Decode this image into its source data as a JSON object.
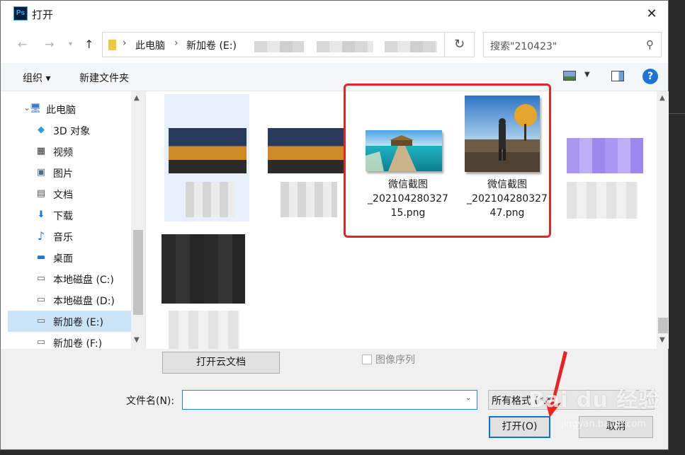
{
  "window": {
    "title": "打开",
    "app_icon_text": "Ps"
  },
  "address": {
    "crumbs": [
      "此电脑",
      "新加卷 (E:)"
    ],
    "search_placeholder": "搜索\"210423\""
  },
  "toolbar": {
    "organize": "组织 ▾",
    "new_folder": "新建文件夹"
  },
  "nav_pane": {
    "items": [
      {
        "label": "此电脑",
        "icon": "computer-icon",
        "glyph": "🖥"
      },
      {
        "label": "3D 对象",
        "icon": "3d-objects-icon",
        "glyph": "◆"
      },
      {
        "label": "视频",
        "icon": "video-icon",
        "glyph": "▦"
      },
      {
        "label": "图片",
        "icon": "pictures-icon",
        "glyph": "▣"
      },
      {
        "label": "文档",
        "icon": "documents-icon",
        "glyph": "▤"
      },
      {
        "label": "下载",
        "icon": "download-icon",
        "glyph": "⬇"
      },
      {
        "label": "音乐",
        "icon": "music-icon",
        "glyph": "♪"
      },
      {
        "label": "桌面",
        "icon": "desktop-icon",
        "glyph": "▬"
      },
      {
        "label": "本地磁盘 (C:)",
        "icon": "drive-c-icon",
        "glyph": "▭"
      },
      {
        "label": "本地磁盘 (D:)",
        "icon": "drive-d-icon",
        "glyph": "▭"
      },
      {
        "label": "新加卷 (E:)",
        "icon": "drive-e-icon",
        "glyph": "▭"
      },
      {
        "label": "新加卷 (F:)",
        "icon": "drive-f-icon",
        "glyph": "▭"
      }
    ],
    "selected": "新加卷 (E:)"
  },
  "files": [
    {
      "name_line1": "微信截图",
      "name_line2": "_202104280327",
      "name_line3": "15.png"
    },
    {
      "name_line1": "微信截图",
      "name_line2": "_202104280327",
      "name_line3": "47.png"
    }
  ],
  "bottom": {
    "cloud_button": "打开云文档",
    "image_sequence": "图像序列",
    "filename_label": "文件名(N):",
    "filename_value": "",
    "filter_value": "所有格式 (*.*)",
    "open_button": "打开(O)",
    "cancel_button": "取消"
  },
  "watermark": {
    "main": "Bai du 经验",
    "sub": "jingyan.baidu.com"
  },
  "colors": {
    "highlight_red": "#e82323",
    "accent_blue": "#0078d7",
    "selected_bg": "#cce4f7"
  }
}
